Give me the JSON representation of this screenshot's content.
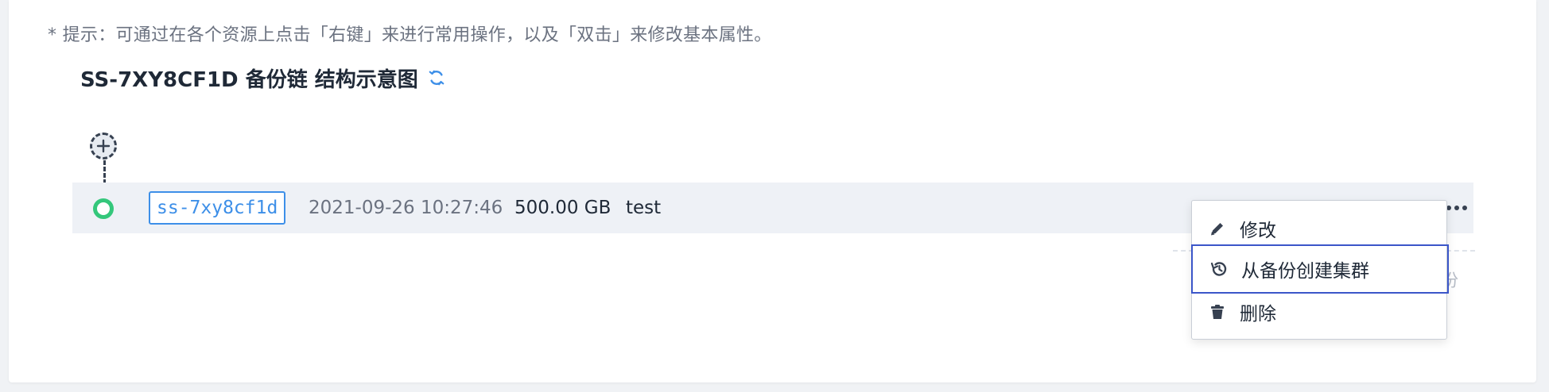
{
  "tip": "* 提示：可通过在各个资源上点击「右键」来进行常用操作，以及「双击」来修改基本属性。",
  "title": "SS-7XY8CF1D 备份链 结构示意图",
  "icons": {
    "refresh": "refresh-icon",
    "add": "plus-icon",
    "more": "more-icon",
    "edit": "pencil-icon",
    "create": "history-icon",
    "delete": "trash-icon"
  },
  "colors": {
    "accent": "#3d8fe8",
    "status_ok": "#34c77b",
    "menu_focus": "#3b56c9"
  },
  "backup": {
    "id": "ss-7xy8cf1d",
    "time": "2021-09-26 10:27:46",
    "size": "500.00 GB",
    "name": "test"
  },
  "peek_text": "份",
  "context_menu": {
    "items": [
      {
        "label": "修改",
        "icon": "pencil-icon"
      },
      {
        "label": "从备份创建集群",
        "icon": "history-icon",
        "focused": true
      },
      {
        "label": "删除",
        "icon": "trash-icon"
      }
    ]
  }
}
